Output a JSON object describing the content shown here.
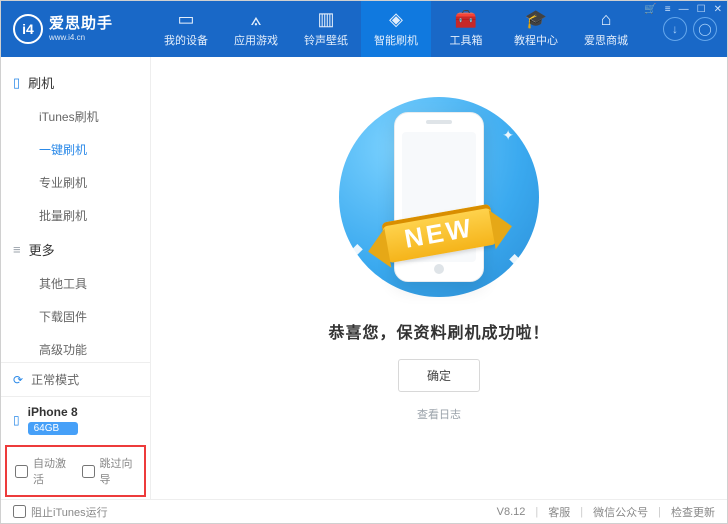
{
  "brand": {
    "name": "爱思助手",
    "url": "www.i4.cn",
    "logo": "i4"
  },
  "nav": [
    {
      "label": "我的设备"
    },
    {
      "label": "应用游戏"
    },
    {
      "label": "铃声壁纸"
    },
    {
      "label": "智能刷机",
      "active": true
    },
    {
      "label": "工具箱"
    },
    {
      "label": "教程中心"
    },
    {
      "label": "爱思商城"
    }
  ],
  "sidebar": {
    "section1": {
      "title": "刷机",
      "items": [
        {
          "label": "iTunes刷机"
        },
        {
          "label": "一键刷机",
          "active": true
        },
        {
          "label": "专业刷机"
        },
        {
          "label": "批量刷机"
        }
      ]
    },
    "section2": {
      "title": "更多",
      "items": [
        {
          "label": "其他工具"
        },
        {
          "label": "下载固件"
        },
        {
          "label": "高级功能"
        }
      ]
    }
  },
  "device": {
    "mode": "正常模式",
    "name": "iPhone 8",
    "storage": "64GB"
  },
  "options": {
    "auto": "自动激活",
    "skip": "跳过向导"
  },
  "main": {
    "ribbon": "NEW",
    "message": "恭喜您，保资料刷机成功啦！",
    "ok": "确定",
    "log": "查看日志"
  },
  "footer": {
    "block": "阻止iTunes运行",
    "version": "V8.12",
    "service": "客服",
    "wechat": "微信公众号",
    "update": "检查更新"
  }
}
